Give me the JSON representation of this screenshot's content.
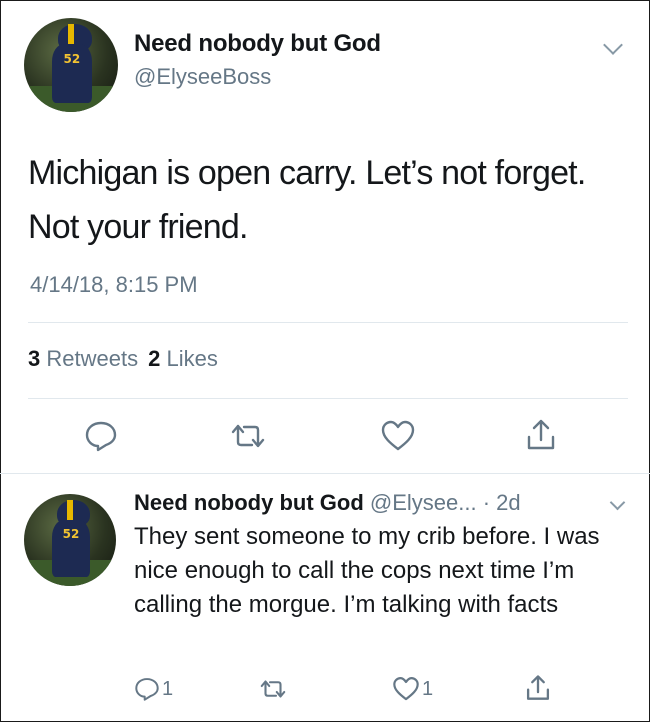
{
  "main_tweet": {
    "author_name": "Need nobody but God",
    "handle": "@ElyseeBoss",
    "text": "Michigan is open carry. Let’s not forget. Not your friend.",
    "timestamp": "4/14/18, 8:15 PM",
    "retweets_count": "3",
    "retweets_label": "Retweets",
    "likes_count": "2",
    "likes_label": "Likes",
    "avatar_number": "52"
  },
  "reply_tweet": {
    "author_name": "Need nobody but God",
    "handle": "@Elysee...",
    "time": "· 2d",
    "text": "They sent someone to my crib before. I was nice enough to call the cops next time I’m calling the morgue. I’m talking with facts",
    "reply_count": "1",
    "like_count": "1",
    "avatar_number": "52"
  },
  "icons": {
    "reply": "reply-bubble-icon",
    "retweet": "retweet-icon",
    "like": "heart-icon",
    "share": "share-icon",
    "more": "chevron-down-icon"
  },
  "colors": {
    "text_primary": "#14171a",
    "text_secondary": "#657786",
    "divider": "#e1e8ed"
  }
}
